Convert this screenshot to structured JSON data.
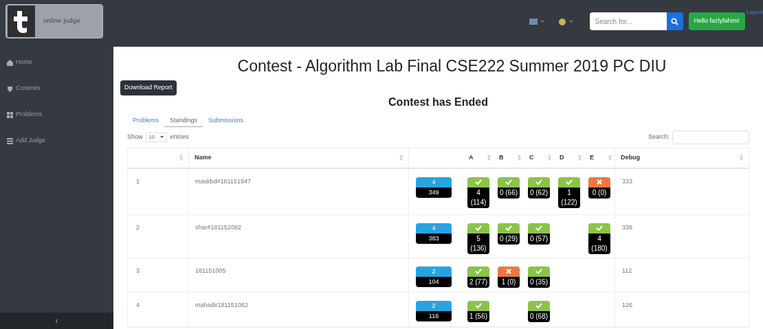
{
  "navbar": {
    "logo_text": "online judge",
    "search": {
      "placeholder": "Search for..."
    },
    "greeting_button": "Hello fazlyfahim!",
    "logout_link": "Logout"
  },
  "sidebar": {
    "items": [
      {
        "label": "Home"
      },
      {
        "label": "Contests"
      },
      {
        "label": "Problems"
      },
      {
        "label": "Add Judge"
      }
    ],
    "collapse_toggle": "‹"
  },
  "title": "Contest - Algorithm Lab Final CSE222 Summer 2019 PC DIU",
  "download_button": "Download Report",
  "status": "Contest has Ended",
  "tabs": [
    {
      "label": "Problems",
      "selected": false
    },
    {
      "label": "Standings",
      "selected": true
    },
    {
      "label": "Submissions",
      "selected": false
    }
  ],
  "length_control": {
    "prefix": "Show",
    "value": "10",
    "suffix": "entries"
  },
  "search_label": "Search:",
  "table": {
    "columns": [
      "Name",
      "A",
      "B",
      "C",
      "D",
      "E",
      "Debug"
    ],
    "rows": [
      {
        "rank": "1",
        "name": "maskbd#181151947",
        "solved": "4",
        "penalty": "349",
        "problems": [
          {
            "kind": "accepted",
            "text": "4 (114)"
          },
          {
            "kind": "accepted",
            "text": "0 (66)"
          },
          {
            "kind": "accepted",
            "text": "0 (62)"
          },
          {
            "kind": "accepted",
            "text": "1 (122)"
          },
          {
            "kind": "rejected",
            "text": "0 (0)"
          }
        ],
        "debug": "333"
      },
      {
        "rank": "2",
        "name": "shar#181152082",
        "solved": "4",
        "penalty": "383",
        "problems": [
          {
            "kind": "accepted",
            "text": "5 (136)"
          },
          {
            "kind": "accepted",
            "text": "0 (29)"
          },
          {
            "kind": "accepted",
            "text": "0 (57)"
          },
          {
            "kind": "empty"
          },
          {
            "kind": "accepted",
            "text": "4 (180)"
          }
        ],
        "debug": "338"
      },
      {
        "rank": "3",
        "name": "181151005",
        "solved": "2",
        "penalty": "104",
        "problems": [
          {
            "kind": "accepted",
            "text": "2 (77)"
          },
          {
            "kind": "rejected",
            "text": "1 (0)"
          },
          {
            "kind": "accepted",
            "text": "0 (35)"
          },
          {
            "kind": "empty"
          },
          {
            "kind": "empty"
          }
        ],
        "debug": "112"
      },
      {
        "rank": "4",
        "name": "mahadir181151062",
        "solved": "2",
        "penalty": "116",
        "problems": [
          {
            "kind": "accepted",
            "text": "1 (56)"
          },
          {
            "kind": "empty"
          },
          {
            "kind": "accepted",
            "text": "0 (68)"
          },
          {
            "kind": "empty"
          },
          {
            "kind": "empty"
          }
        ],
        "debug": "126"
      }
    ]
  }
}
